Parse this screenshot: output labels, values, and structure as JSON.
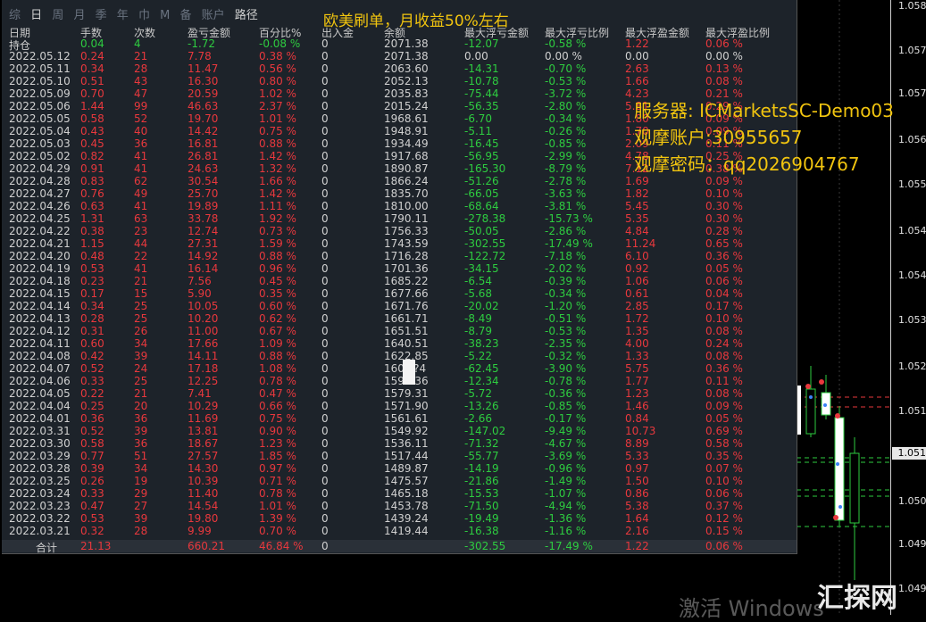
{
  "tabs": [
    "综",
    "日",
    "周",
    "月",
    "季",
    "年",
    "巾",
    "M",
    "备",
    "账户",
    "路径"
  ],
  "banner": "欧美刷单，月收益50%左右",
  "headers": [
    "日期",
    "手数",
    "次数",
    "盈亏金额",
    "百分比%",
    "出入金",
    "余额",
    "最大浮亏金额",
    "最大浮亏比例",
    "最大浮盈金额",
    "最大浮盈比例"
  ],
  "rows": [
    [
      "持仓",
      "0.04",
      "4",
      "-1.72",
      "-0.08 %",
      "0",
      "2071.38",
      "-12.07",
      "-0.58 %",
      "1.22",
      "0.06 %"
    ],
    [
      "2022.05.12",
      "0.24",
      "21",
      "7.78",
      "0.38 %",
      "0",
      "2071.38",
      "0.00",
      "0.00 %",
      "0.00",
      "0.00 %"
    ],
    [
      "2022.05.11",
      "0.34",
      "28",
      "11.47",
      "0.56 %",
      "0",
      "2063.60",
      "-14.31",
      "-0.70 %",
      "2.63",
      "0.13 %"
    ],
    [
      "2022.05.10",
      "0.51",
      "43",
      "16.30",
      "0.80 %",
      "0",
      "2052.13",
      "-10.78",
      "-0.53 %",
      "1.66",
      "0.08 %"
    ],
    [
      "2022.05.09",
      "0.70",
      "47",
      "20.59",
      "1.02 %",
      "0",
      "2035.83",
      "-75.44",
      "-3.72 %",
      "4.23",
      "0.21 %"
    ],
    [
      "2022.05.06",
      "1.44",
      "99",
      "46.63",
      "2.37 %",
      "0",
      "2015.24",
      "-56.35",
      "-2.80 %",
      "5.81",
      "0.29 %"
    ],
    [
      "2022.05.05",
      "0.58",
      "52",
      "19.70",
      "1.01 %",
      "0",
      "1968.61",
      "-6.70",
      "-0.34 %",
      "1.80",
      "0.09 %"
    ],
    [
      "2022.05.04",
      "0.43",
      "40",
      "14.42",
      "0.75 %",
      "0",
      "1948.91",
      "-5.11",
      "-0.26 %",
      "1.70",
      "0.09 %"
    ],
    [
      "2022.05.03",
      "0.45",
      "36",
      "16.81",
      "0.88 %",
      "0",
      "1934.49",
      "-16.45",
      "-0.85 %",
      "2.09",
      "0.11 %"
    ],
    [
      "2022.05.02",
      "0.82",
      "41",
      "26.81",
      "1.42 %",
      "0",
      "1917.68",
      "-56.95",
      "-2.99 %",
      "4.78",
      "0.25 %"
    ],
    [
      "2022.04.29",
      "0.91",
      "41",
      "24.63",
      "1.32 %",
      "0",
      "1890.87",
      "-165.30",
      "-8.79 %",
      "7.12",
      "0.38 %"
    ],
    [
      "2022.04.28",
      "0.83",
      "62",
      "30.54",
      "1.66 %",
      "0",
      "1866.24",
      "-51.26",
      "-2.78 %",
      "1.69",
      "0.09 %"
    ],
    [
      "2022.04.27",
      "0.76",
      "49",
      "25.70",
      "1.42 %",
      "0",
      "1835.70",
      "-66.05",
      "-3.63 %",
      "1.82",
      "0.10 %"
    ],
    [
      "2022.04.26",
      "0.63",
      "41",
      "19.89",
      "1.11 %",
      "0",
      "1810.00",
      "-68.64",
      "-3.81 %",
      "5.45",
      "0.30 %"
    ],
    [
      "2022.04.25",
      "1.31",
      "63",
      "33.78",
      "1.92 %",
      "0",
      "1790.11",
      "-278.38",
      "-15.73 %",
      "5.35",
      "0.30 %"
    ],
    [
      "2022.04.22",
      "0.38",
      "23",
      "12.74",
      "0.73 %",
      "0",
      "1756.33",
      "-50.05",
      "-2.86 %",
      "4.84",
      "0.28 %"
    ],
    [
      "2022.04.21",
      "1.15",
      "44",
      "27.31",
      "1.59 %",
      "0",
      "1743.59",
      "-302.55",
      "-17.49 %",
      "11.24",
      "0.65 %"
    ],
    [
      "2022.04.20",
      "0.48",
      "22",
      "14.92",
      "0.88 %",
      "0",
      "1716.28",
      "-122.72",
      "-7.18 %",
      "6.10",
      "0.36 %"
    ],
    [
      "2022.04.19",
      "0.53",
      "41",
      "16.14",
      "0.96 %",
      "0",
      "1701.36",
      "-34.15",
      "-2.02 %",
      "0.92",
      "0.05 %"
    ],
    [
      "2022.04.18",
      "0.23",
      "21",
      "7.56",
      "0.45 %",
      "0",
      "1685.22",
      "-6.54",
      "-0.39 %",
      "1.06",
      "0.06 %"
    ],
    [
      "2022.04.15",
      "0.17",
      "15",
      "5.90",
      "0.35 %",
      "0",
      "1677.66",
      "-5.68",
      "-0.34 %",
      "0.61",
      "0.04 %"
    ],
    [
      "2022.04.14",
      "0.34",
      "25",
      "10.05",
      "0.60 %",
      "0",
      "1671.76",
      "-20.02",
      "-1.20 %",
      "2.85",
      "0.17 %"
    ],
    [
      "2022.04.13",
      "0.28",
      "25",
      "10.20",
      "0.62 %",
      "0",
      "1661.71",
      "-8.49",
      "-0.51 %",
      "1.72",
      "0.10 %"
    ],
    [
      "2022.04.12",
      "0.31",
      "26",
      "11.00",
      "0.67 %",
      "0",
      "1651.51",
      "-8.79",
      "-0.53 %",
      "1.35",
      "0.08 %"
    ],
    [
      "2022.04.11",
      "0.60",
      "34",
      "17.66",
      "1.09 %",
      "0",
      "1640.51",
      "-38.23",
      "-2.35 %",
      "4.00",
      "0.24 %"
    ],
    [
      "2022.04.08",
      "0.42",
      "39",
      "14.11",
      "0.88 %",
      "0",
      "1622.85",
      "-5.22",
      "-0.32 %",
      "1.33",
      "0.08 %"
    ],
    [
      "2022.04.07",
      "0.52",
      "24",
      "17.18",
      "1.08 %",
      "0",
      "160?.?4",
      "-62.45",
      "-3.90 %",
      "5.75",
      "0.36 %"
    ],
    [
      "2022.04.06",
      "0.33",
      "25",
      "12.25",
      "0.78 %",
      "0",
      "1591.36",
      "-12.34",
      "-0.78 %",
      "1.77",
      "0.11 %"
    ],
    [
      "2022.04.05",
      "0.22",
      "21",
      "7.41",
      "0.47 %",
      "0",
      "1579.31",
      "-5.72",
      "-0.36 %",
      "1.23",
      "0.08 %"
    ],
    [
      "2022.04.04",
      "0.25",
      "20",
      "10.29",
      "0.66 %",
      "0",
      "1571.90",
      "-13.26",
      "-0.85 %",
      "1.46",
      "0.09 %"
    ],
    [
      "2022.04.01",
      "0.36",
      "36",
      "11.69",
      "0.75 %",
      "0",
      "1561.61",
      "-2.66",
      "-0.17 %",
      "0.84",
      "0.05 %"
    ],
    [
      "2022.03.31",
      "0.52",
      "39",
      "13.81",
      "0.90 %",
      "0",
      "1549.92",
      "-147.02",
      "-9.49 %",
      "10.73",
      "0.69 %"
    ],
    [
      "2022.03.30",
      "0.58",
      "36",
      "18.67",
      "1.23 %",
      "0",
      "1536.11",
      "-71.32",
      "-4.67 %",
      "8.89",
      "0.58 %"
    ],
    [
      "2022.03.29",
      "0.77",
      "51",
      "27.57",
      "1.85 %",
      "0",
      "1517.44",
      "-55.77",
      "-3.69 %",
      "5.33",
      "0.35 %"
    ],
    [
      "2022.03.28",
      "0.39",
      "34",
      "14.30",
      "0.97 %",
      "0",
      "1489.87",
      "-14.19",
      "-0.96 %",
      "0.97",
      "0.07 %"
    ],
    [
      "2022.03.25",
      "0.26",
      "19",
      "10.39",
      "0.71 %",
      "0",
      "1475.57",
      "-21.86",
      "-1.49 %",
      "1.50",
      "0.10 %"
    ],
    [
      "2022.03.24",
      "0.33",
      "29",
      "11.40",
      "0.78 %",
      "0",
      "1465.18",
      "-15.53",
      "-1.07 %",
      "0.86",
      "0.06 %"
    ],
    [
      "2022.03.23",
      "0.47",
      "27",
      "14.54",
      "1.01 %",
      "0",
      "1453.78",
      "-71.50",
      "-4.94 %",
      "5.38",
      "0.37 %"
    ],
    [
      "2022.03.22",
      "0.53",
      "39",
      "19.80",
      "1.39 %",
      "0",
      "1439.24",
      "-19.49",
      "-1.36 %",
      "1.64",
      "0.12 %"
    ],
    [
      "2022.03.21",
      "0.32",
      "28",
      "9.99",
      "0.70 %",
      "0",
      "1419.44",
      "-16.38",
      "-1.16 %",
      "2.16",
      "0.15 %"
    ]
  ],
  "total": [
    "合计",
    "21.13",
    "",
    "660.21",
    "46.84 %",
    "0",
    "",
    "-302.55",
    "-17.49 %",
    "1.22",
    "0.06 %"
  ],
  "overlay": {
    "server": "服务器: ICMarketsSC-Demo03",
    "account": "观摩账户:30955657",
    "password": "观摩密码：qq2026904767"
  },
  "price_labels": [
    "1.058",
    "1.057",
    "1.057",
    "1.056",
    "1.055",
    "1.054",
    "1.054",
    "1.053",
    "1.052",
    "1.051",
    "1.051",
    "1.050",
    "1.049",
    "1.049"
  ],
  "current_price": "1.051",
  "watermark": "激活 Windows",
  "logo": "汇探网",
  "colors": {
    "red": "#e8383d",
    "green": "#2ecc40",
    "panel": "#1d232a",
    "banner": "#f1c40f"
  }
}
